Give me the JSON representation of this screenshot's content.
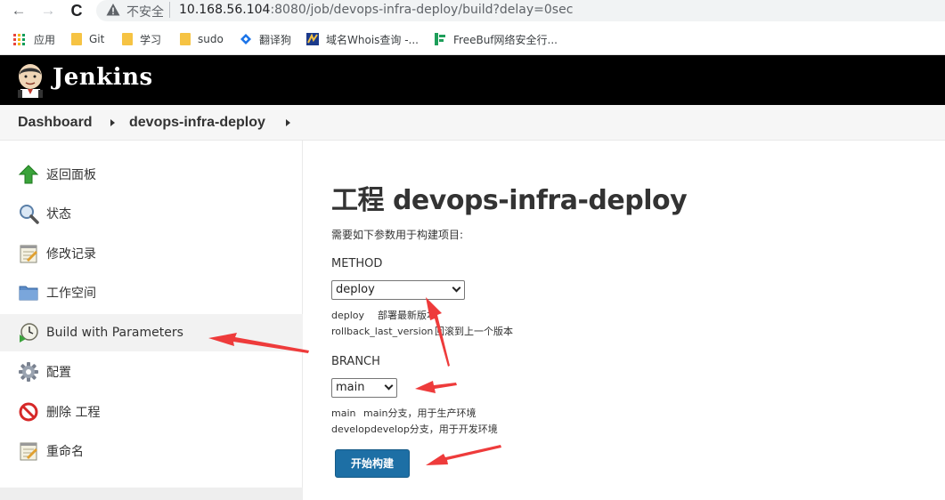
{
  "browser": {
    "back_glyph": "←",
    "forward_glyph": "→",
    "reload_glyph": "C",
    "insecure_label": "不安全",
    "url_host": "10.168.56.104",
    "url_path": ":8080/job/devops-infra-deploy/build?delay=0sec",
    "bookmarks": [
      {
        "label": "应用",
        "icon": "apps-icon"
      },
      {
        "label": "Git",
        "icon": "folder-icon"
      },
      {
        "label": "学习",
        "icon": "folder-icon"
      },
      {
        "label": "sudo",
        "icon": "folder-icon"
      },
      {
        "label": "翻译狗",
        "icon": "translate-icon"
      },
      {
        "label": "域名Whois查询 -...",
        "icon": "whois-icon"
      },
      {
        "label": "FreeBuf网络安全行...",
        "icon": "freebuf-icon"
      }
    ]
  },
  "header": {
    "title": "Jenkins"
  },
  "breadcrumb": {
    "items": [
      "Dashboard",
      "devops-infra-deploy"
    ]
  },
  "sidebar": {
    "items": [
      {
        "label": "返回面板",
        "icon": "up-arrow-icon"
      },
      {
        "label": "状态",
        "icon": "search-icon"
      },
      {
        "label": "修改记录",
        "icon": "notepad-icon"
      },
      {
        "label": "工作空间",
        "icon": "folder-icon"
      },
      {
        "label": "Build with Parameters",
        "icon": "clock-icon"
      },
      {
        "label": "配置",
        "icon": "gear-icon"
      },
      {
        "label": "删除 工程",
        "icon": "no-entry-icon"
      },
      {
        "label": "重命名",
        "icon": "notepad-icon"
      }
    ]
  },
  "main": {
    "title": "工程 devops-infra-deploy",
    "description": "需要如下参数用于构建项目:",
    "params": [
      {
        "name": "METHOD",
        "selected": "deploy",
        "choices": [
          {
            "value": "deploy",
            "desc": "部署最新版本"
          },
          {
            "value": "rollback_last_version",
            "desc": "回滚到上一个版本"
          }
        ]
      },
      {
        "name": "BRANCH",
        "selected": "main",
        "choices": [
          {
            "value": "main",
            "desc": "main分支，用于生产环境"
          },
          {
            "value": "develop",
            "desc": "develop分支，用于开发环境"
          }
        ]
      }
    ],
    "build_button": "开始构建"
  },
  "colors": {
    "header_bg": "#000000",
    "build_button": "#1d6fa5",
    "annotation_arrow": "#ee3b3b"
  }
}
